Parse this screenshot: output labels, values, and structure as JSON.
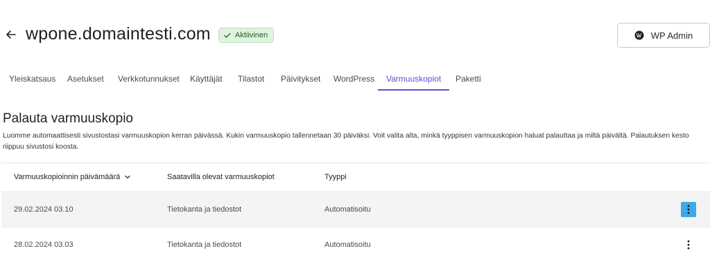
{
  "header": {
    "title": "wpone.domaintesti.com",
    "status_badge": "Aktiivinen",
    "wp_admin_label": "WP Admin",
    "icons": {
      "back": "arrow-left-icon",
      "status": "check-icon",
      "wp": "wordpress-icon"
    }
  },
  "tabs": [
    {
      "label": "Yleiskatsaus",
      "active": false
    },
    {
      "label": "Asetukset",
      "active": false
    },
    {
      "label": "Verkkotunnukset",
      "active": false
    },
    {
      "label": "Käyttäjät",
      "active": false
    },
    {
      "label": "Tilastot",
      "active": false
    },
    {
      "label": "Päivitykset",
      "active": false
    },
    {
      "label": "WordPress",
      "active": false
    },
    {
      "label": "Varmuuskopiot",
      "active": true
    },
    {
      "label": "Paketti",
      "active": false
    }
  ],
  "section": {
    "title": "Palauta varmuuskopio",
    "description": "Luomme automaattisesti sivustostasi varmuuskopion kerran päivässä. Kukin varmuuskopio tallennetaan 30 päiväksi. Voit valita alta, minkä tyyppisen varmuuskopion haluat palauttaa ja miltä päivältä. Palautuksen kesto riippuu sivustosi koosta."
  },
  "table": {
    "columns": [
      "Varmuuskopioinnin päivämäärä",
      "Saatavilla olevat varmuuskopiot",
      "Tyyppi"
    ],
    "rows": [
      {
        "date": "29.02.2024 03.10",
        "backups": "Tietokanta ja tiedostot",
        "type": "Automatisoitu"
      },
      {
        "date": "28.02.2024 03.03",
        "backups": "Tietokanta ja tiedostot",
        "type": "Automatisoitu"
      }
    ]
  },
  "colors": {
    "accent": "#5b4fd1",
    "badge_bg": "#dff3df",
    "focus": "#3fa9e8"
  }
}
